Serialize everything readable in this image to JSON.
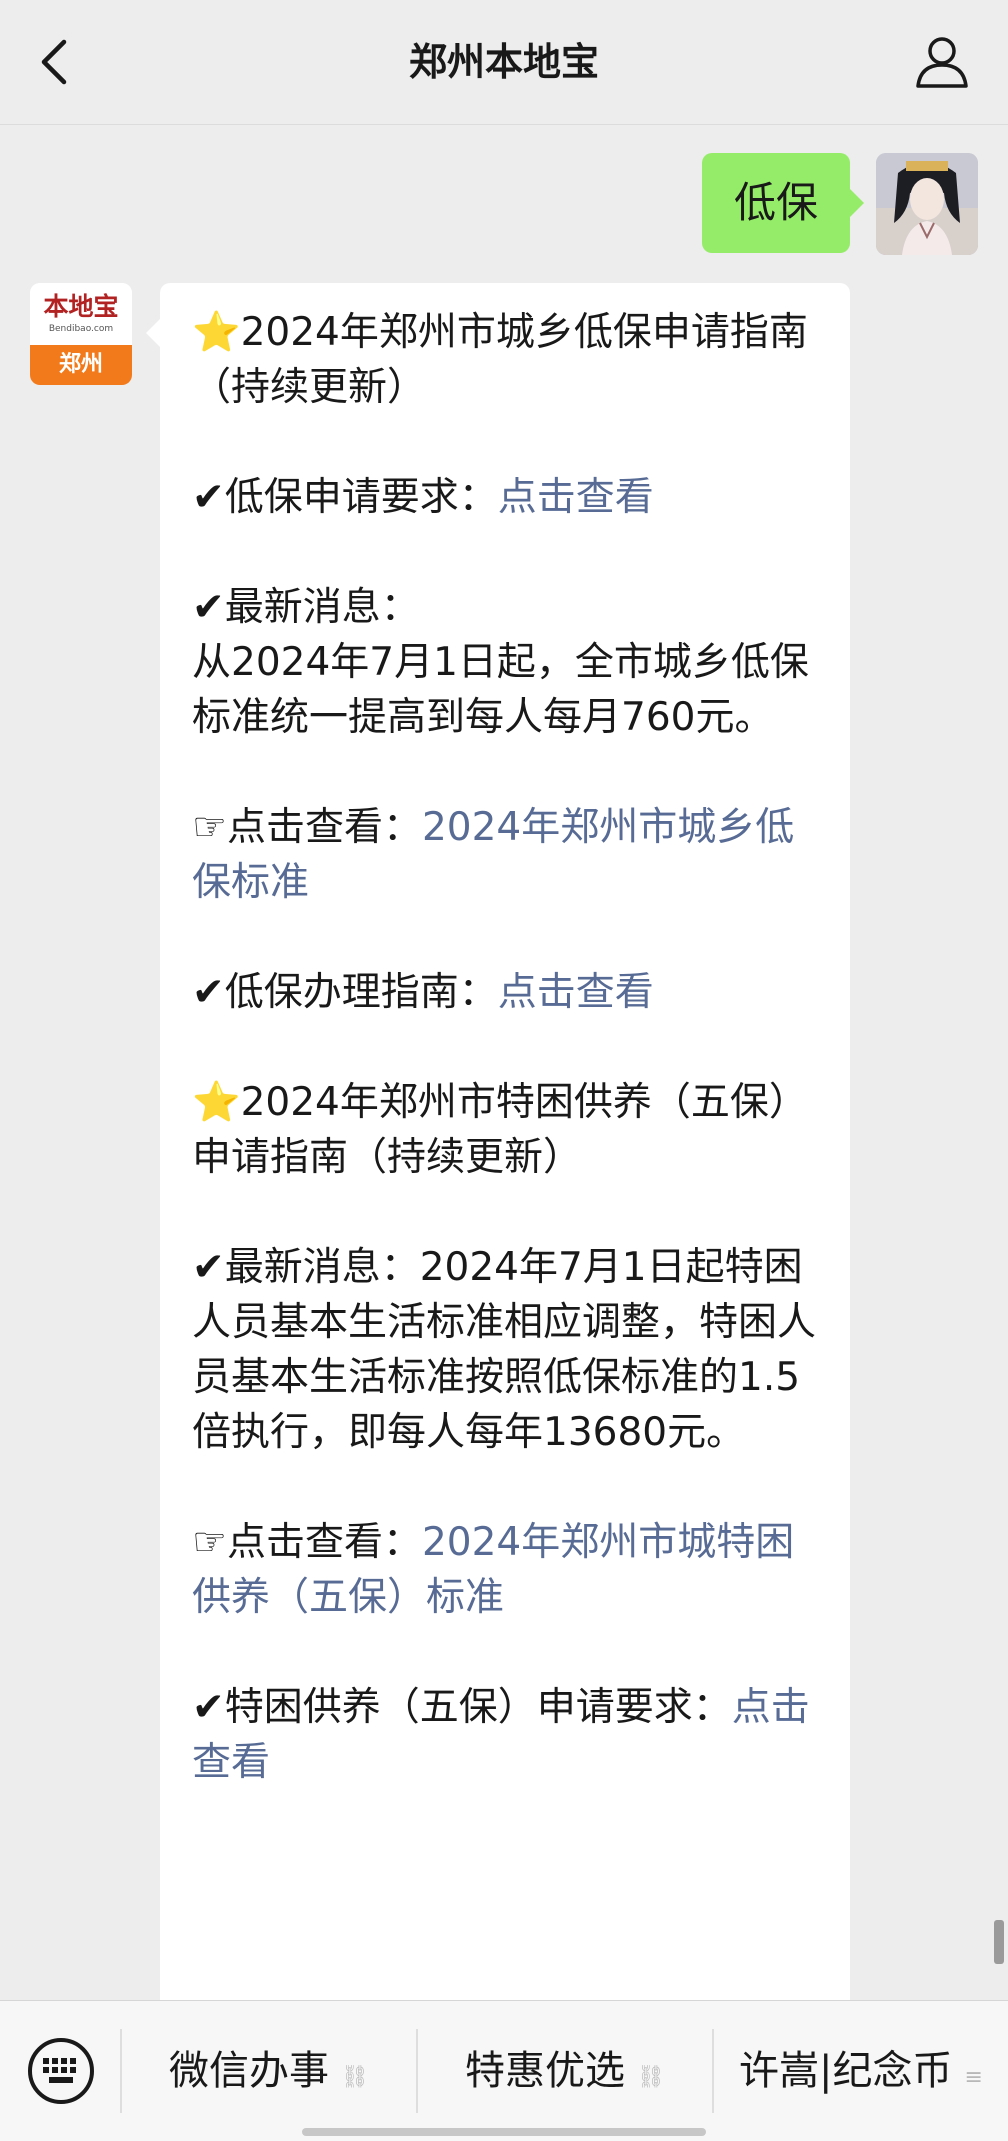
{
  "header": {
    "title": "郑州本地宝",
    "back_icon": "chevron-left-icon",
    "profile_icon": "person-icon"
  },
  "chat": {
    "me_message": "低保",
    "bot_avatar": {
      "brand": "本地宝",
      "url": "Bendibao.com",
      "city": "郑州"
    },
    "bot_message": {
      "s1_star": "⭐",
      "s1_title": "2024年郑州市城乡低保申请指南（持续更新）",
      "s2_check": "✔",
      "s2_label": "低保申请要求：",
      "s2_link": "点击查看",
      "s3_check": "✔",
      "s3_label": "最新消息：",
      "s3_text": "从2024年7月1日起，全市城乡低保标准统一提高到每人每月760元。",
      "s4_hand": "☞",
      "s4_label": "点击查看：",
      "s4_link": "2024年郑州市城乡低保标准",
      "s5_check": "✔",
      "s5_label": "低保办理指南：",
      "s5_link": "点击查看",
      "s6_star": "⭐",
      "s6_title": "2024年郑州市特困供养（五保）申请指南（持续更新）",
      "s7_check": "✔",
      "s7_text": "最新消息：2024年7月1日起特困人员基本生活标准相应调整，特困人员基本生活标准按照低保标准的1.5倍执行，即每人每年13680元。",
      "s8_hand": "☞",
      "s8_label": "点击查看：",
      "s8_link": "2024年郑州市城特困供养（五保）标准",
      "s9_check": "✔",
      "s9_label": "特困供养（五保）申请要求：",
      "s9_link": "点击查看"
    }
  },
  "menu": {
    "keyboard_icon": "keyboard-icon",
    "items": [
      {
        "label": "微信办事",
        "icon": "link-icon"
      },
      {
        "label": "特惠优选",
        "icon": "link-icon"
      },
      {
        "label": "许嵩|纪念币",
        "icon": "menu-lines-icon"
      }
    ]
  }
}
